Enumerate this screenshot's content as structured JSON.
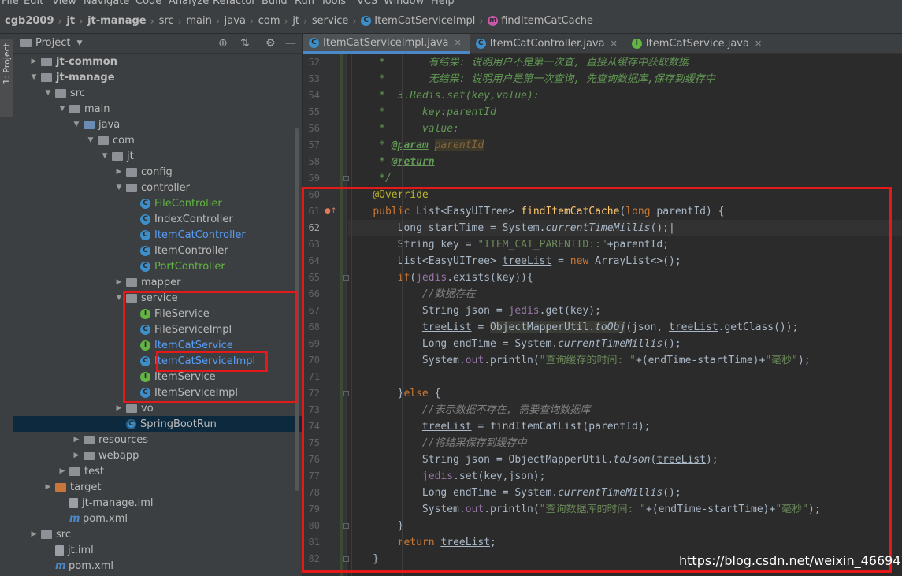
{
  "menu": [
    "File",
    "Edit",
    "View",
    "Navigate",
    "Code",
    "Analyze",
    "Refactor",
    "Build",
    "Run",
    "Tools",
    "VCS",
    "Window",
    "Help"
  ],
  "breadcrumb": [
    {
      "label": "cgb2009",
      "bold": true
    },
    {
      "label": "jt",
      "bold": true
    },
    {
      "label": "jt-manage",
      "bold": true
    },
    {
      "label": "src"
    },
    {
      "label": "main"
    },
    {
      "label": "java"
    },
    {
      "label": "com"
    },
    {
      "label": "jt"
    },
    {
      "label": "service"
    },
    {
      "label": "ItemCatServiceImpl",
      "icon": "class-icon"
    },
    {
      "label": "findItemCatCache",
      "icon": "method-icon"
    }
  ],
  "toolwindow_tab": "1: Project",
  "project_panel": {
    "title": "Project"
  },
  "tree": [
    {
      "label": "jt-common",
      "indent": 1,
      "arrow": "right",
      "icon": "folder",
      "bold": true
    },
    {
      "label": "jt-manage",
      "indent": 1,
      "arrow": "down",
      "icon": "folder",
      "bold": true
    },
    {
      "label": "src",
      "indent": 2,
      "arrow": "down",
      "icon": "folder"
    },
    {
      "label": "main",
      "indent": 3,
      "arrow": "down",
      "icon": "folder"
    },
    {
      "label": "java",
      "indent": 4,
      "arrow": "down",
      "icon": "folder-blue"
    },
    {
      "label": "com",
      "indent": 5,
      "arrow": "down",
      "icon": "folder"
    },
    {
      "label": "jt",
      "indent": 6,
      "arrow": "down",
      "icon": "folder"
    },
    {
      "label": "config",
      "indent": 7,
      "arrow": "right",
      "icon": "folder"
    },
    {
      "label": "controller",
      "indent": 7,
      "arrow": "down",
      "icon": "folder"
    },
    {
      "label": "FileController",
      "indent": 8,
      "icon": "class",
      "color": "green"
    },
    {
      "label": "IndexController",
      "indent": 8,
      "icon": "class"
    },
    {
      "label": "ItemCatController",
      "indent": 8,
      "icon": "class",
      "color": "blue"
    },
    {
      "label": "ItemController",
      "indent": 8,
      "icon": "class"
    },
    {
      "label": "PortController",
      "indent": 8,
      "icon": "class",
      "color": "green"
    },
    {
      "label": "mapper",
      "indent": 7,
      "arrow": "right",
      "icon": "folder"
    },
    {
      "label": "service",
      "indent": 7,
      "arrow": "down",
      "icon": "folder"
    },
    {
      "label": "FileService",
      "indent": 8,
      "icon": "interface"
    },
    {
      "label": "FileServiceImpl",
      "indent": 8,
      "icon": "class"
    },
    {
      "label": "ItemCatService",
      "indent": 8,
      "icon": "interface",
      "color": "blue"
    },
    {
      "label": "ItemCatServiceImpl",
      "indent": 8,
      "icon": "class",
      "color": "blue"
    },
    {
      "label": "ItemService",
      "indent": 8,
      "icon": "interface"
    },
    {
      "label": "ItemServiceImpl",
      "indent": 8,
      "icon": "class"
    },
    {
      "label": "vo",
      "indent": 7,
      "arrow": "right",
      "icon": "folder"
    },
    {
      "label": "SpringBootRun",
      "indent": 7,
      "icon": "run-class",
      "selected": true
    },
    {
      "label": "resources",
      "indent": 4,
      "arrow": "right",
      "icon": "folder"
    },
    {
      "label": "webapp",
      "indent": 4,
      "arrow": "right",
      "icon": "folder"
    },
    {
      "label": "test",
      "indent": 3,
      "arrow": "right",
      "icon": "folder"
    },
    {
      "label": "target",
      "indent": 2,
      "arrow": "right",
      "icon": "folder-orange"
    },
    {
      "label": "jt-manage.iml",
      "indent": 3,
      "icon": "file"
    },
    {
      "label": "pom.xml",
      "indent": 3,
      "icon": "maven"
    },
    {
      "label": "src",
      "indent": 1,
      "arrow": "right",
      "icon": "folder"
    },
    {
      "label": "jt.iml",
      "indent": 2,
      "icon": "file"
    },
    {
      "label": "pom.xml",
      "indent": 2,
      "icon": "maven"
    }
  ],
  "tabs": [
    {
      "label": "ItemCatServiceImpl.java",
      "icon": "class",
      "active": true
    },
    {
      "label": "ItemCatController.java",
      "icon": "class"
    },
    {
      "label": "ItemCatService.java",
      "icon": "interface"
    }
  ],
  "code_lines": [
    {
      "n": "52",
      "segs": [
        [
          "     *       ",
          "c"
        ],
        [
          "有结果: 说明用户不是第一次查, 直接从缓存中获取数据",
          "c"
        ]
      ]
    },
    {
      "n": "53",
      "segs": [
        [
          "     *       ",
          "c"
        ],
        [
          "无结果: 说明用户是第一次查询, 先查询数据库,保存到缓存中",
          "c"
        ]
      ]
    },
    {
      "n": "54",
      "segs": [
        [
          "     *  3.Redis.set(key,value):",
          "c"
        ]
      ]
    },
    {
      "n": "55",
      "segs": [
        [
          "     *      key:parentId",
          "c"
        ]
      ]
    },
    {
      "n": "56",
      "segs": [
        [
          "     *      value:",
          "c"
        ]
      ]
    },
    {
      "n": "57",
      "segs": [
        [
          "     * ",
          "c"
        ],
        [
          "@param",
          "tag"
        ],
        [
          " ",
          "c"
        ],
        [
          "parentId",
          "ptag"
        ]
      ]
    },
    {
      "n": "58",
      "segs": [
        [
          "     * ",
          "c"
        ],
        [
          "@return",
          "tag"
        ]
      ]
    },
    {
      "n": "59",
      "segs": [
        [
          "     */",
          "c"
        ]
      ]
    },
    {
      "n": "60",
      "segs": [
        [
          "    ",
          "p"
        ],
        [
          "@Override",
          "ann"
        ]
      ]
    },
    {
      "n": "61",
      "segs": [
        [
          "    ",
          "p"
        ],
        [
          "public ",
          "k"
        ],
        [
          "List<EasyUITree> ",
          "p"
        ],
        [
          "findItemCatCache",
          "fn"
        ],
        [
          "(",
          "p"
        ],
        [
          "long ",
          "k"
        ],
        [
          "parentId) {",
          "p"
        ]
      ]
    },
    {
      "n": "62",
      "cur": true,
      "segs": [
        [
          "        Long startTime = System.",
          "p"
        ],
        [
          "currentTimeMillis",
          "it"
        ],
        [
          "();",
          "p"
        ]
      ]
    },
    {
      "n": "63",
      "segs": [
        [
          "        String key = ",
          "p"
        ],
        [
          "\"ITEM_CAT_PARENTID::\"",
          "s"
        ],
        [
          "+parentId;",
          "p"
        ]
      ]
    },
    {
      "n": "64",
      "segs": [
        [
          "        List<EasyUITree> ",
          "p"
        ],
        [
          "treeList",
          "u"
        ],
        [
          " = ",
          "p"
        ],
        [
          "new ",
          "k"
        ],
        [
          "ArrayList<>();",
          "p"
        ]
      ]
    },
    {
      "n": "65",
      "segs": [
        [
          "        ",
          "p"
        ],
        [
          "if",
          "k"
        ],
        [
          "(",
          "p"
        ],
        [
          "jedis",
          "f"
        ],
        [
          ".exists(key)){",
          "p"
        ]
      ]
    },
    {
      "n": "66",
      "segs": [
        [
          "            ",
          "p"
        ],
        [
          "//数据存在",
          "cm"
        ]
      ]
    },
    {
      "n": "67",
      "segs": [
        [
          "            String json = ",
          "p"
        ],
        [
          "jedis",
          "f"
        ],
        [
          ".get(key);",
          "p"
        ]
      ]
    },
    {
      "n": "68",
      "segs": [
        [
          "            ",
          "p"
        ],
        [
          "treeList",
          "u"
        ],
        [
          " = ",
          "p"
        ],
        [
          "ObjectMapperUtil.",
          "hl"
        ],
        [
          "toObj",
          "hli"
        ],
        [
          "(json, ",
          "p"
        ],
        [
          "treeList",
          "u"
        ],
        [
          ".getClass());",
          "p"
        ]
      ]
    },
    {
      "n": "69",
      "segs": [
        [
          "            Long endTime = System.",
          "p"
        ],
        [
          "currentTimeMillis",
          "it"
        ],
        [
          "();",
          "p"
        ]
      ]
    },
    {
      "n": "70",
      "segs": [
        [
          "            System.",
          "p"
        ],
        [
          "out",
          "f"
        ],
        [
          ".println(",
          "p"
        ],
        [
          "\"查询缓存的时间: \"",
          "s"
        ],
        [
          "+(endTime-startTime)+",
          "p"
        ],
        [
          "\"毫秒\"",
          "s"
        ],
        [
          ");",
          "p"
        ]
      ]
    },
    {
      "n": "71",
      "segs": [
        [
          "",
          "p"
        ]
      ]
    },
    {
      "n": "72",
      "segs": [
        [
          "        }",
          "p"
        ],
        [
          "else ",
          "k"
        ],
        [
          "{",
          "p"
        ]
      ]
    },
    {
      "n": "73",
      "segs": [
        [
          "            ",
          "p"
        ],
        [
          "//表示数据不存在, 需要查询数据库",
          "cm"
        ]
      ]
    },
    {
      "n": "74",
      "segs": [
        [
          "            ",
          "p"
        ],
        [
          "treeList",
          "u"
        ],
        [
          " = findItemCatList(parentId);",
          "p"
        ]
      ]
    },
    {
      "n": "75",
      "segs": [
        [
          "            ",
          "p"
        ],
        [
          "//将结果保存到缓存中",
          "cm"
        ]
      ]
    },
    {
      "n": "76",
      "segs": [
        [
          "            String json = ObjectMapperUtil.",
          "p"
        ],
        [
          "toJson",
          "it"
        ],
        [
          "(",
          "p"
        ],
        [
          "treeList",
          "u"
        ],
        [
          ");",
          "p"
        ]
      ]
    },
    {
      "n": "77",
      "segs": [
        [
          "            ",
          "p"
        ],
        [
          "jedis",
          "f"
        ],
        [
          ".set(key,json);",
          "p"
        ]
      ]
    },
    {
      "n": "78",
      "segs": [
        [
          "            Long endTime = System.",
          "p"
        ],
        [
          "currentTimeMillis",
          "it"
        ],
        [
          "();",
          "p"
        ]
      ]
    },
    {
      "n": "79",
      "segs": [
        [
          "            System.",
          "p"
        ],
        [
          "out",
          "f"
        ],
        [
          ".println(",
          "p"
        ],
        [
          "\"查询数据库的时间: \"",
          "s"
        ],
        [
          "+(endTime-startTime)+",
          "p"
        ],
        [
          "\"毫秒\"",
          "s"
        ],
        [
          ");",
          "p"
        ]
      ]
    },
    {
      "n": "80",
      "segs": [
        [
          "        }",
          "p"
        ]
      ]
    },
    {
      "n": "81",
      "segs": [
        [
          "        ",
          "p"
        ],
        [
          "return ",
          "k"
        ],
        [
          "treeList",
          "u"
        ],
        [
          ";",
          "p"
        ]
      ]
    },
    {
      "n": "82",
      "segs": [
        [
          "    }",
          "p"
        ]
      ]
    }
  ],
  "watermark": "https://blog.csdn.net/weixin_46694747",
  "colors": {
    "keyword": "#cc7832",
    "string": "#6a8759",
    "comment": "#629755",
    "field": "#9876aa",
    "method": "#ffc66d",
    "annotation": "#bbb529",
    "highlight_box": "#e41a1a"
  }
}
